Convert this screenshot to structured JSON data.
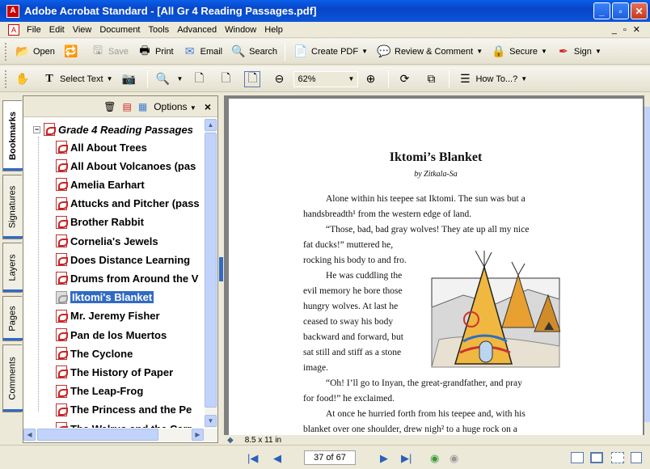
{
  "window": {
    "title": "Adobe Acrobat Standard - [All Gr 4 Reading Passages.pdf]"
  },
  "menu": [
    "File",
    "Edit",
    "View",
    "Document",
    "Tools",
    "Advanced",
    "Window",
    "Help"
  ],
  "toolbar1": {
    "open": "Open",
    "save": "Save",
    "print": "Print",
    "email": "Email",
    "search": "Search",
    "create_pdf": "Create PDF",
    "review": "Review & Comment",
    "secure": "Secure",
    "sign": "Sign"
  },
  "toolbar2": {
    "select_text": "Select Text",
    "zoom": "62%",
    "howto": "How To...?"
  },
  "nav_tabs": [
    "Bookmarks",
    "Signatures",
    "Layers",
    "Pages",
    "Comments"
  ],
  "bookmarks": {
    "options_label": "Options",
    "close_label": "×",
    "root": "Grade 4 Reading Passages",
    "items": [
      "All About Trees",
      "All About Volcanoes (pas",
      "Amelia Earhart",
      "Attucks and Pitcher (pass",
      "Brother Rabbit",
      "Cornelia's Jewels",
      "Does Distance Learning",
      "Drums from Around the V",
      "Iktomi's Blanket",
      "Mr. Jeremy Fisher",
      "Pan de los Muertos",
      "The Cyclone",
      "The History of Paper",
      "The Leap-Frog",
      "The Princess and the Pe",
      "The Walrus and the Carr"
    ],
    "selected_index": 8
  },
  "document": {
    "title": "Iktomi’s Blanket",
    "author": "by Zitkala-Sa",
    "lines": [
      "Alone within his teepee sat Iktomi. The sun was but a",
      "handsbreadth¹ from the western edge of land.",
      "“Those, bad, bad gray wolves! They ate up all my nice",
      "fat ducks!” muttered he,",
      "rocking his body to and fro.",
      "He was cuddling the",
      "evil memory he bore those",
      "hungry wolves. At last he",
      "ceased to sway his body",
      "backward and forward, but",
      "sat still and stiff as a stone",
      "image.",
      "“Oh! I’ll go to Inyan, the great-grandfather, and pray",
      "for food!” he exclaimed.",
      "At once he hurried forth from his teepee and, with his",
      "blanket over one shoulder, drew nigh² to a huge rock on a"
    ],
    "page_size": "8.5 x 11 in"
  },
  "status": {
    "page_counter": "37 of 67"
  },
  "colors": {
    "titlebar": "#0a55d8",
    "selection": "#316ac5",
    "pdf_icon": "#c22"
  }
}
